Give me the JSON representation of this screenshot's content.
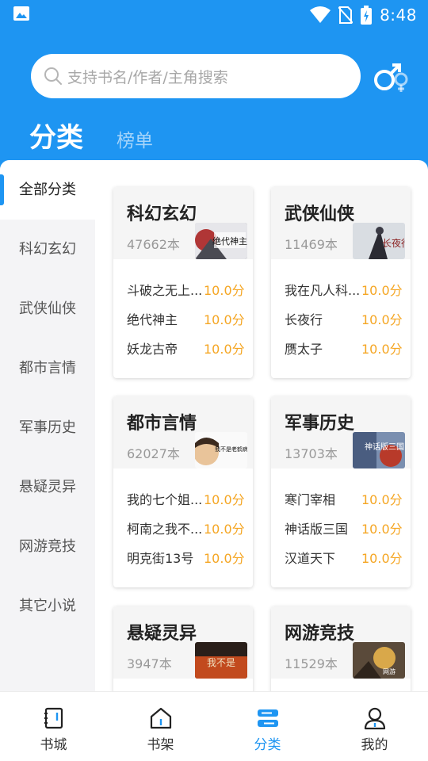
{
  "status": {
    "time": "8:48"
  },
  "search": {
    "placeholder": "支持书名/作者/主角搜索"
  },
  "header": {
    "tab_category": "分类",
    "tab_rank": "榜单"
  },
  "sidebar": {
    "items": [
      {
        "label": "全部分类"
      },
      {
        "label": "科幻玄幻"
      },
      {
        "label": "武侠仙侠"
      },
      {
        "label": "都市言情"
      },
      {
        "label": "军事历史"
      },
      {
        "label": "悬疑灵异"
      },
      {
        "label": "网游竞技"
      },
      {
        "label": "其它小说"
      }
    ]
  },
  "cards": [
    {
      "title": "科幻玄幻",
      "count": "47662本",
      "cover_text": "绝代神主",
      "books": [
        {
          "name": "斗破之无上...",
          "score": "10.0分"
        },
        {
          "name": "绝代神主",
          "score": "10.0分"
        },
        {
          "name": "妖龙古帝",
          "score": "10.0分"
        }
      ]
    },
    {
      "title": "武侠仙侠",
      "count": "11469本",
      "cover_text": "长夜行",
      "books": [
        {
          "name": "我在凡人科...",
          "score": "10.0分"
        },
        {
          "name": "长夜行",
          "score": "10.0分"
        },
        {
          "name": "赝太子",
          "score": "10.0分"
        }
      ]
    },
    {
      "title": "都市言情",
      "count": "62027本",
      "cover_text": "我不是老鹤病",
      "books": [
        {
          "name": "我的七个姐...",
          "score": "10.0分"
        },
        {
          "name": "柯南之我不...",
          "score": "10.0分"
        },
        {
          "name": "明克街13号",
          "score": "10.0分"
        }
      ]
    },
    {
      "title": "军事历史",
      "count": "13703本",
      "cover_text": "神话版三国",
      "books": [
        {
          "name": "寒门宰相",
          "score": "10.0分"
        },
        {
          "name": "神话版三国",
          "score": "10.0分"
        },
        {
          "name": "汉道天下",
          "score": "10.0分"
        }
      ]
    },
    {
      "title": "悬疑灵异",
      "count": "3947本",
      "cover_text": "我不是",
      "books": []
    },
    {
      "title": "网游竞技",
      "count": "11529本",
      "cover_text": "网游",
      "books": []
    }
  ],
  "bottom_nav": [
    {
      "label": "书城",
      "icon": "book-icon"
    },
    {
      "label": "书架",
      "icon": "house-icon"
    },
    {
      "label": "分类",
      "icon": "category-icon"
    },
    {
      "label": "我的",
      "icon": "user-icon"
    }
  ],
  "colors": {
    "primary": "#1E95F2",
    "score": "#F5A623"
  }
}
